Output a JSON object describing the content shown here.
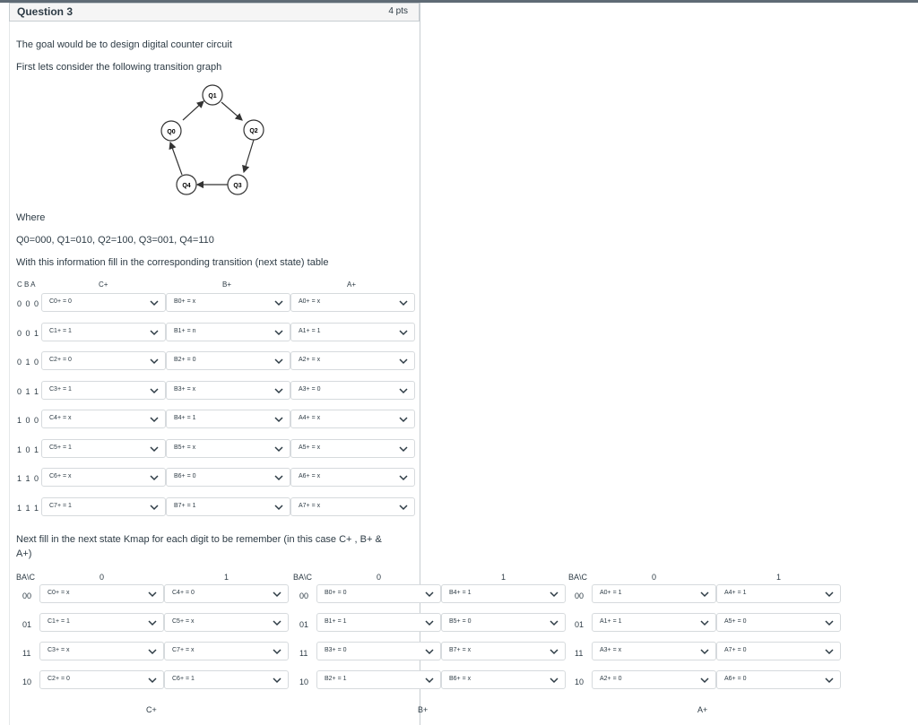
{
  "question": {
    "title": "Question 3",
    "points": "4 pts"
  },
  "intro": {
    "line1": "The goal would be to design digital counter circuit",
    "line2": "First lets consider the following transition graph"
  },
  "graph": {
    "nodes": [
      "Q0",
      "Q1",
      "Q2",
      "Q3",
      "Q4"
    ]
  },
  "where": {
    "label": "Where",
    "states": "Q0=000,  Q1=010,  Q2=100,  Q3=001, Q4=110",
    "instruction": "With this information fill in the corresponding transition (next state) table"
  },
  "table": {
    "headers": {
      "cba": "C B A",
      "c": "C+",
      "b": "B+",
      "a": "A+"
    },
    "rows": [
      {
        "label": "0 0 0",
        "c": "C0+ = 0",
        "b": "B0+ = x",
        "a": "A0+ = x"
      },
      {
        "label": "0 0 1",
        "c": "C1+ = 1",
        "b": "B1+ = n",
        "a": "A1+ = 1"
      },
      {
        "label": "0 1 0",
        "c": "C2+ = 0",
        "b": "B2+ = 0",
        "a": "A2+ = x"
      },
      {
        "label": "0 1 1",
        "c": "C3+ = 1",
        "b": "B3+ = x",
        "a": "A3+ = 0"
      },
      {
        "label": "1 0 0",
        "c": "C4+ = x",
        "b": "B4+ = 1",
        "a": "A4+ = x"
      },
      {
        "label": "1 0 1",
        "c": "C5+ = 1",
        "b": "B5+ = x",
        "a": "A5+ = x"
      },
      {
        "label": "1 1 0",
        "c": "C6+ = x",
        "b": "B6+ = 0",
        "a": "A6+ = x"
      },
      {
        "label": "1 1 1",
        "c": "C7+ = 1",
        "b": "B7+ = 1",
        "a": "A7+ = x"
      }
    ]
  },
  "kmap_intro": {
    "line1": "Next fill in the next state Kmap for each digit to be remember (in this case  C+ , B+ &",
    "line2": "A+)"
  },
  "kmaps": [
    {
      "corner": "BA\\C",
      "col0": "0",
      "col1": "1",
      "footer": "C+",
      "rows": [
        {
          "label": "00",
          "v0": "C0+ = x",
          "v1": "C4+ = 0"
        },
        {
          "label": "01",
          "v0": "C1+ = 1",
          "v1": "C5+ = x"
        },
        {
          "label": "11",
          "v0": "C3+ = x",
          "v1": "C7+ = x"
        },
        {
          "label": "10",
          "v0": "C2+ = 0",
          "v1": "C6+ = 1"
        }
      ]
    },
    {
      "corner": "BA\\C",
      "col0": "0",
      "col1": "1",
      "footer": "B+",
      "rows": [
        {
          "label": "00",
          "v0": "B0+ = 0",
          "v1": "B4+ = 1"
        },
        {
          "label": "01",
          "v0": "B1+ = 1",
          "v1": "B5+ = 0"
        },
        {
          "label": "11",
          "v0": "B3+ = 0",
          "v1": "B7+ = x"
        },
        {
          "label": "10",
          "v0": "B2+ = 1",
          "v1": "B6+ = x"
        }
      ]
    },
    {
      "corner": "BA\\C",
      "col0": "0",
      "col1": "1",
      "footer": "A+",
      "rows": [
        {
          "label": "00",
          "v0": "A0+ = 1",
          "v1": "A4+ = 1"
        },
        {
          "label": "01",
          "v0": "A1+ = 1",
          "v1": "A5+ = 0"
        },
        {
          "label": "11",
          "v0": "A3+ = x",
          "v1": "A7+ = 0"
        },
        {
          "label": "10",
          "v0": "A2+ = 0",
          "v1": "A6+ = 0"
        }
      ]
    }
  ]
}
